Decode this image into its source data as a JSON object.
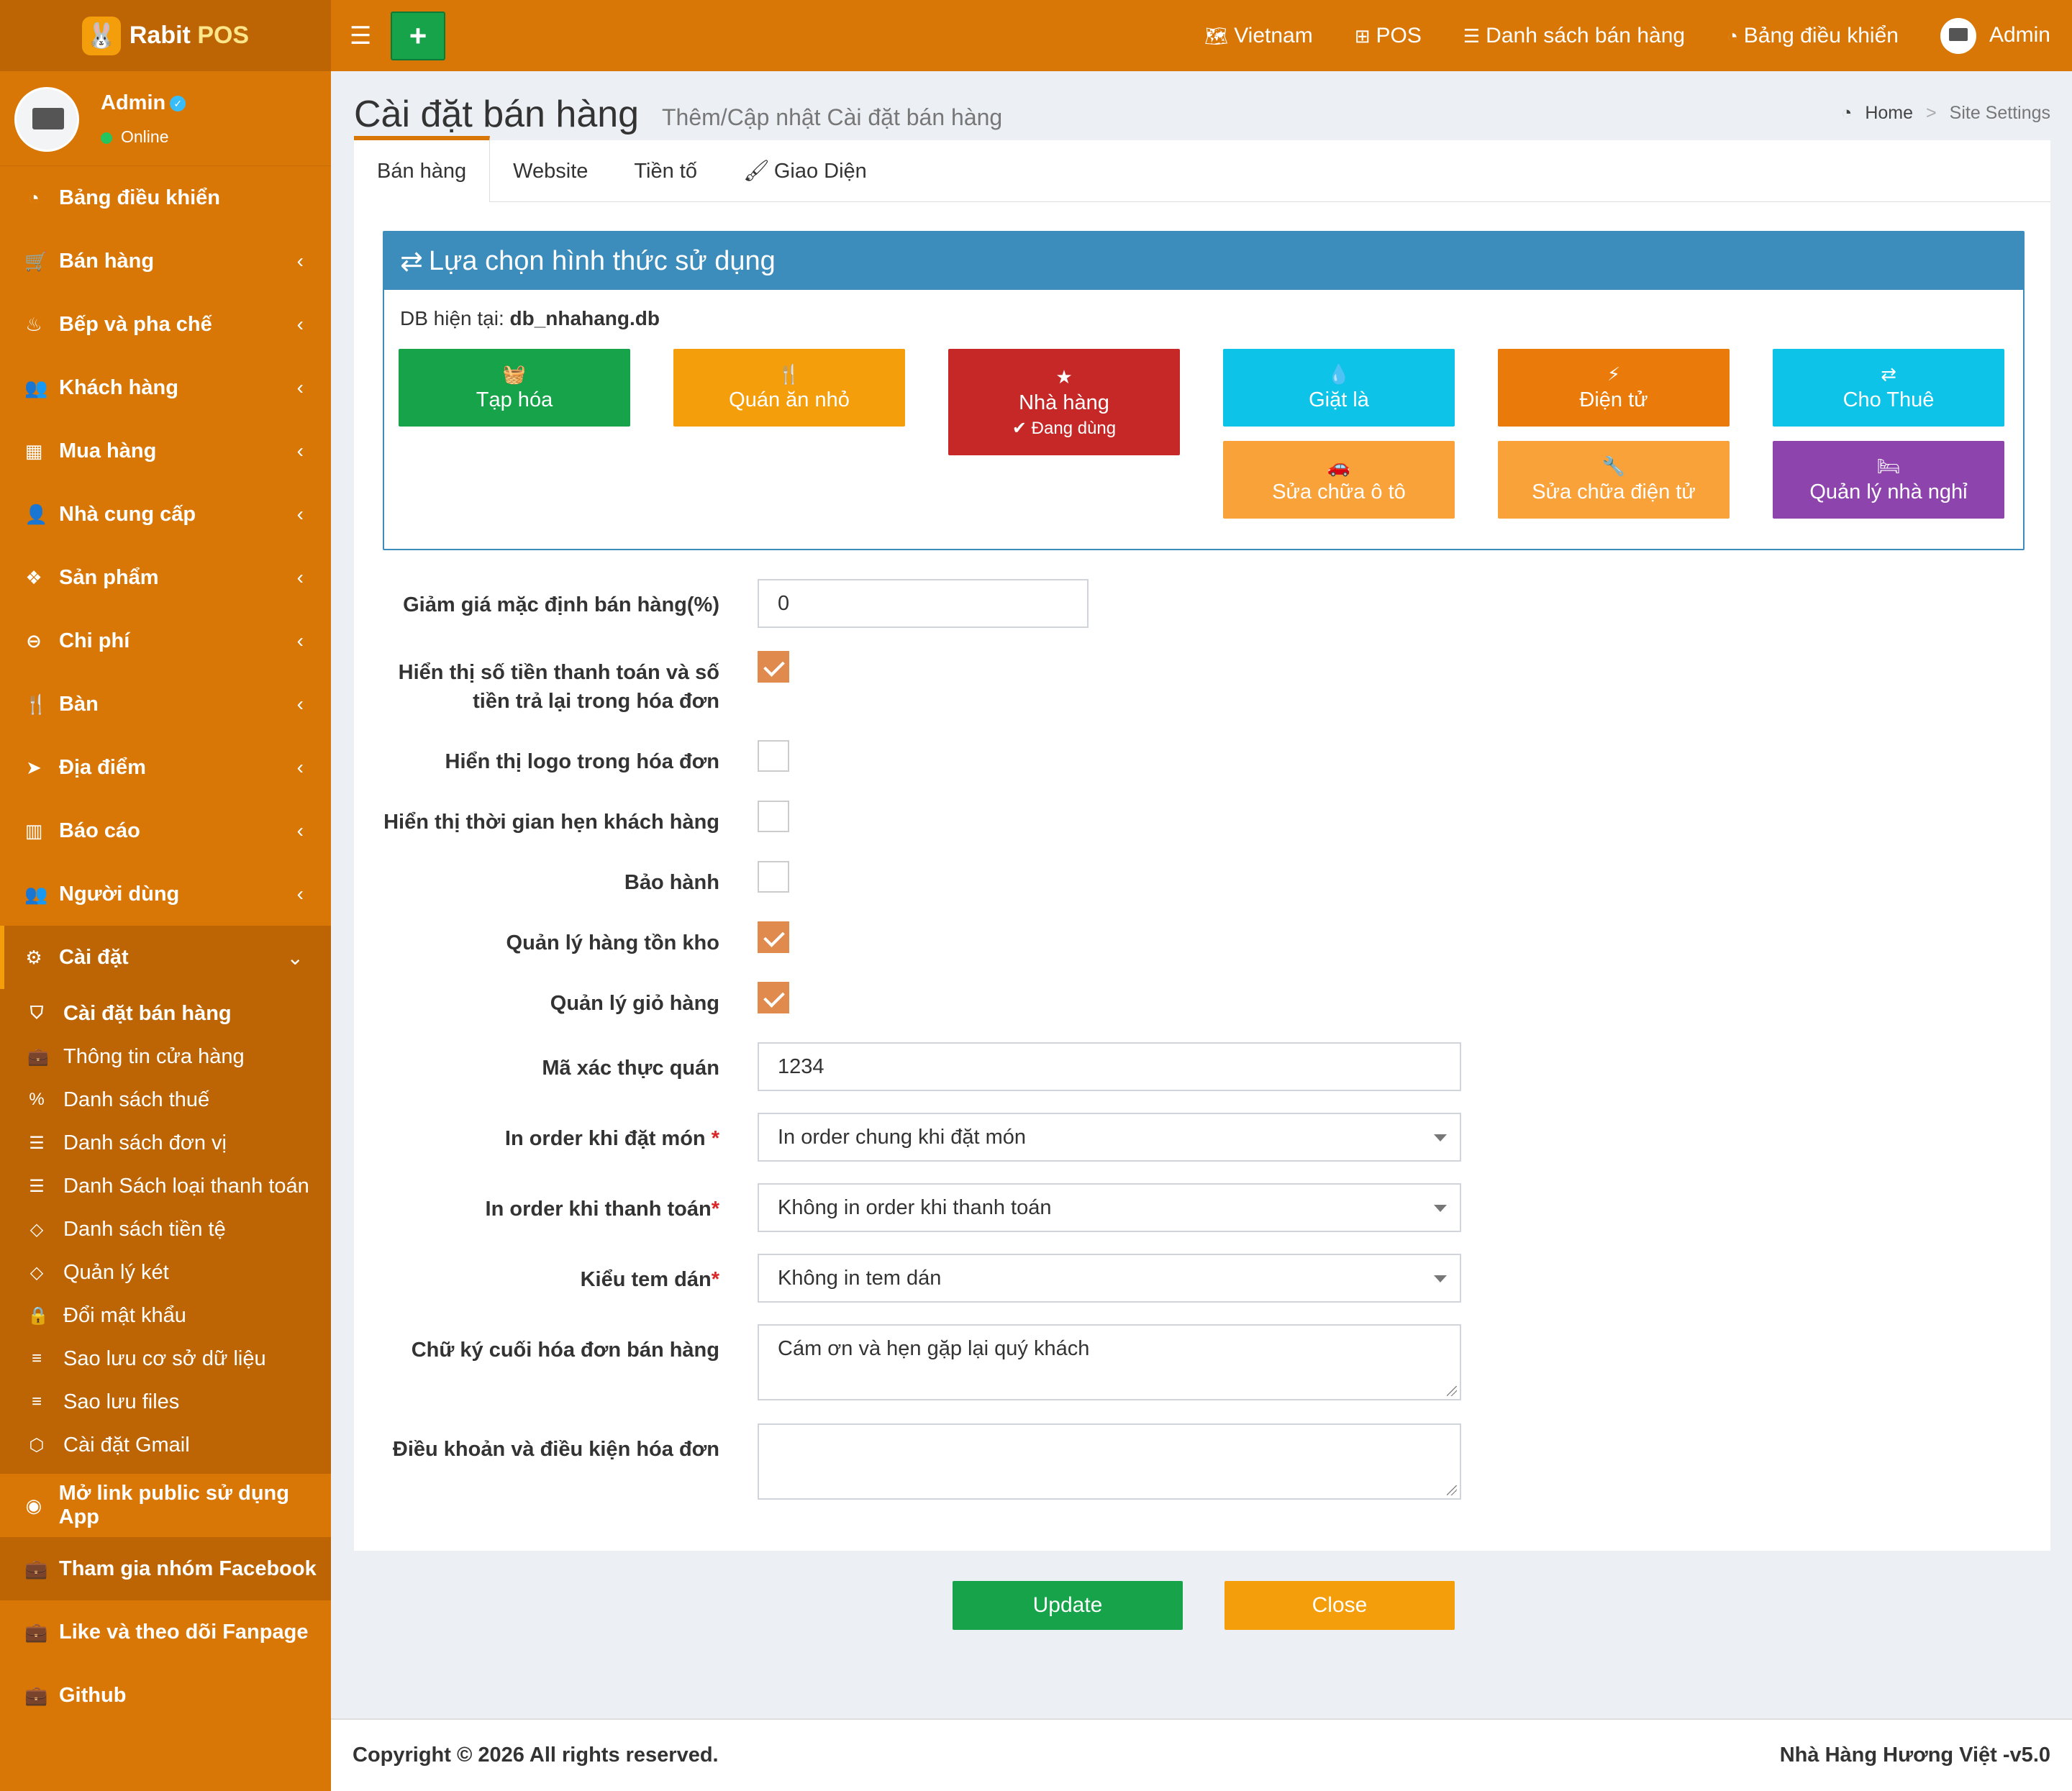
{
  "app": {
    "logo_left": "Rabit",
    "logo_right": "POS"
  },
  "topnav": {
    "lang": "Vietnam",
    "pos": "POS",
    "sales_list": "Danh sách bán hàng",
    "dashboard": "Bảng điều khiển",
    "user": "Admin"
  },
  "sidebar": {
    "user": {
      "name": "Admin",
      "status": "Online"
    },
    "items": [
      {
        "label": "Bảng điều khiển",
        "icon": "dashboard-icon"
      },
      {
        "label": "Bán hàng",
        "icon": "cart-icon"
      },
      {
        "label": "Bếp và pha chế",
        "icon": "chef-icon"
      },
      {
        "label": "Khách hàng",
        "icon": "users-icon"
      },
      {
        "label": "Mua hàng",
        "icon": "grid-icon"
      },
      {
        "label": "Nhà cung cấp",
        "icon": "user-plus-icon"
      },
      {
        "label": "Sản phẩm",
        "icon": "cubes-icon"
      },
      {
        "label": "Chi phí",
        "icon": "minus-circle-icon"
      },
      {
        "label": "Bàn",
        "icon": "cutlery-icon"
      },
      {
        "label": "Địa điểm",
        "icon": "location-arrow-icon"
      },
      {
        "label": "Báo cáo",
        "icon": "bar-chart-icon"
      },
      {
        "label": "Người dùng",
        "icon": "users-icon"
      },
      {
        "label": "Cài đặt",
        "icon": "gears-icon"
      }
    ],
    "sub": [
      "Cài đặt bán hàng",
      "Thông tin cửa hàng",
      "Danh sách thuế",
      "Danh sách đơn vị",
      "Danh Sách loại thanh toán",
      "Danh sách tiền tệ",
      "Quản lý két",
      "Đổi mật khẩu",
      "Sao lưu cơ sở dữ liệu",
      "Sao lưu files",
      "Cài đặt Gmail"
    ],
    "extra": [
      "Mở link public sử dụng App",
      "Tham gia nhóm Facebook",
      "Like và theo dõi Fanpage",
      "Github"
    ]
  },
  "page": {
    "title": "Cài đặt bán hàng",
    "subtitle": "Thêm/Cập nhật Cài đặt bán hàng",
    "breadcrumb_home": "Home",
    "breadcrumb_current": "Site Settings"
  },
  "tabs": [
    "Bán hàng",
    "Website",
    "Tiền tố",
    "Giao Diện"
  ],
  "mode": {
    "title": "Lựa chọn hình thức sử dụng",
    "db_label": "DB hiện tại:",
    "db_value": "db_nhahang.db",
    "buttons": [
      {
        "label": "Tạp hóa",
        "icon": "basket-icon",
        "color": "#16a34a"
      },
      {
        "label": "Quán ăn nhỏ",
        "icon": "cutlery-icon",
        "color": "#f59e0b"
      },
      {
        "label": "Nhà hàng",
        "icon": "star-icon",
        "color": "#c62828",
        "note": "Đang dùng"
      },
      {
        "label": "Giặt là",
        "icon": "droplet-icon",
        "color": "#0dc3e8"
      },
      {
        "label": "Điện tử",
        "icon": "bolt-icon",
        "color": "#ea7a0a"
      },
      {
        "label": "Cho Thuê",
        "icon": "exchange-icon",
        "color": "#0dc3e8"
      },
      {
        "label": "Sửa chữa ô tô",
        "icon": "car-icon",
        "color": "#f9a23a"
      },
      {
        "label": "Sửa chữa điện tử",
        "icon": "wrench-icon",
        "color": "#f9a23a"
      },
      {
        "label": "Quản lý nhà nghỉ",
        "icon": "bed-icon",
        "color": "#8e44ad"
      }
    ]
  },
  "form": {
    "discount_label": "Giảm giá mặc định bán hàng(%)",
    "discount_value": "0",
    "show_payment_label_1": "Hiển thị số tiền thanh toán và số",
    "show_payment_label_2": "tiền trả lại trong hóa đơn",
    "show_payment": true,
    "show_logo_label": "Hiển thị logo trong hóa đơn",
    "show_logo": false,
    "show_appt_label": "Hiển thị thời gian hẹn khách hàng",
    "show_appt": false,
    "warranty_label": "Bảo hành",
    "warranty": false,
    "stock_label": "Quản lý hàng tồn kho",
    "stock": true,
    "cart_label": "Quản lý giỏ hàng",
    "cart": true,
    "auth_label": "Mã xác thực quán",
    "auth_value": "1234",
    "print_order_label": "In order khi đặt món",
    "print_order_value": "In order chung khi đặt món",
    "print_pay_label": "In order khi thanh toán",
    "print_pay_value": "Không in order khi thanh toán",
    "sticker_label": "Kiểu tem dán",
    "sticker_value": "Không in tem dán",
    "sign_label": "Chữ ký cuối hóa đơn bán hàng",
    "sign_value": "Cám ơn và hẹn gặp lại quý khách",
    "terms_label": "Điều khoản và điều kiện hóa đơn",
    "terms_value": "",
    "required_mark": "*"
  },
  "actions": {
    "update": "Update",
    "close": "Close"
  },
  "footer": {
    "copyright": "Copyright © 2026 All rights reserved.",
    "brand": "Nhà Hàng Hương Việt -v5.0"
  }
}
